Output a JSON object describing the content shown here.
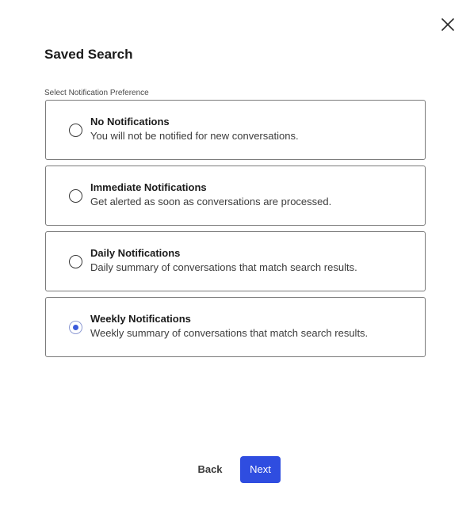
{
  "dialog": {
    "title": "Saved Search",
    "close_icon": "close-icon",
    "group_label": "Select Notification Preference",
    "options": [
      {
        "title": "No Notifications",
        "description": "You will not be notified for new conversations.",
        "selected": false
      },
      {
        "title": "Immediate Notifications",
        "description": "Get alerted as soon as conversations are processed.",
        "selected": false
      },
      {
        "title": "Daily Notifications",
        "description": "Daily summary of conversations that match search results.",
        "selected": false
      },
      {
        "title": "Weekly Notifications",
        "description": "Weekly summary of conversations that match search results.",
        "selected": true
      }
    ],
    "back_label": "Back",
    "next_label": "Next"
  },
  "colors": {
    "primary": "#2f4de0",
    "border": "#7a7a7a",
    "radio_selected": "#3b5bdb"
  }
}
